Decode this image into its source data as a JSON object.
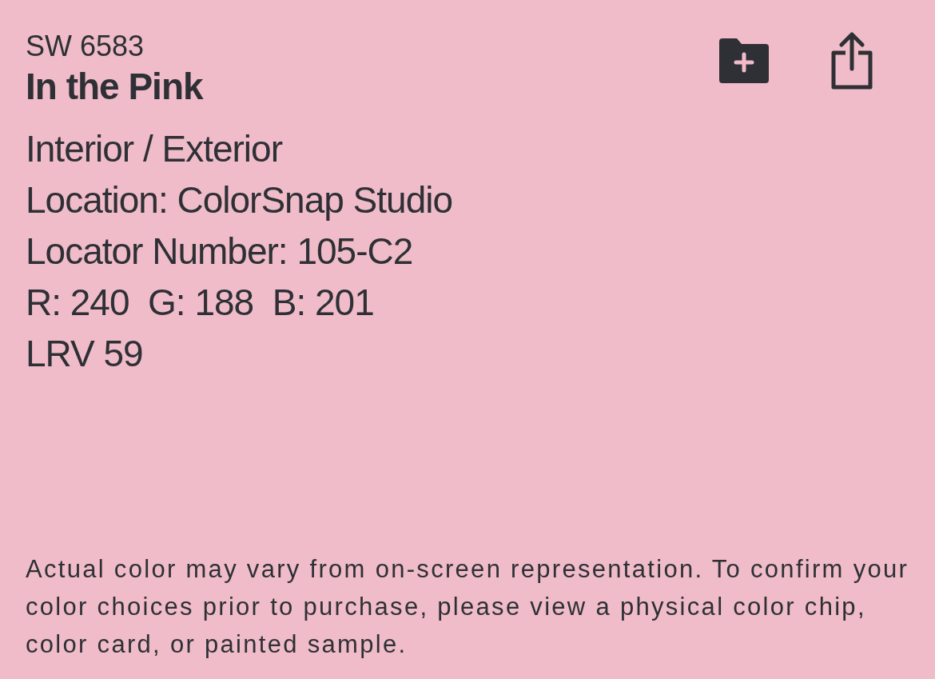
{
  "color": {
    "code": "SW 6583",
    "name": "In the Pink"
  },
  "details": [
    "Interior / Exterior",
    "Location: ColorSnap Studio",
    "Locator Number: 105-C2",
    "R: 240  G: 188  B: 201",
    "LRV 59"
  ],
  "disclaimer": "Actual color may vary from on-screen representation. To confirm your color choices prior to purchase, please view a physical color chip, color card, or painted sample."
}
